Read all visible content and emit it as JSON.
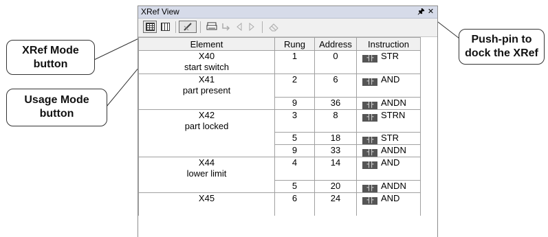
{
  "window": {
    "title": "XRef View",
    "pin_glyph": "↕",
    "close_glyph": "✕"
  },
  "toolbar": {
    "buttons": [
      {
        "name": "xref-mode",
        "icon": "grid-icon",
        "state": "pressed"
      },
      {
        "name": "usage-mode",
        "icon": "list-icon",
        "state": "normal"
      },
      {
        "name": "filter",
        "icon": "pencil-icon",
        "state": "pressed"
      },
      {
        "name": "print",
        "icon": "printer-icon",
        "state": "normal"
      },
      {
        "name": "goto",
        "icon": "jump-icon",
        "state": "disabled"
      },
      {
        "name": "back",
        "icon": "triangle-left-icon",
        "state": "disabled"
      },
      {
        "name": "forward",
        "icon": "triangle-right-icon",
        "state": "disabled"
      },
      {
        "name": "erase",
        "icon": "eraser-icon",
        "state": "disabled"
      }
    ]
  },
  "table": {
    "headers": [
      "Element",
      "Rung",
      "Address",
      "Instruction"
    ],
    "rows": [
      {
        "element": "X40",
        "desc": "start switch",
        "refs": [
          {
            "rung": "1",
            "address": "0",
            "instruction": "STR"
          }
        ]
      },
      {
        "element": "X41",
        "desc": "part present",
        "refs": [
          {
            "rung": "2",
            "address": "6",
            "instruction": "AND"
          },
          {
            "rung": "9",
            "address": "36",
            "instruction": "ANDN"
          }
        ]
      },
      {
        "element": "X42",
        "desc": "part locked",
        "refs": [
          {
            "rung": "3",
            "address": "8",
            "instruction": "STRN"
          },
          {
            "rung": "5",
            "address": "18",
            "instruction": "STR"
          },
          {
            "rung": "9",
            "address": "33",
            "instruction": "ANDN"
          }
        ]
      },
      {
        "element": "X44",
        "desc": "lower limit",
        "refs": [
          {
            "rung": "4",
            "address": "14",
            "instruction": "AND"
          },
          {
            "rung": "5",
            "address": "20",
            "instruction": "ANDN"
          }
        ]
      },
      {
        "element": "X45",
        "desc": "",
        "refs": [
          {
            "rung": "6",
            "address": "24",
            "instruction": "AND"
          }
        ]
      }
    ],
    "contact_glyph": "┤├"
  },
  "callouts": {
    "xref_mode": {
      "line1": "XRef Mode",
      "line2": "button"
    },
    "usage_mode": {
      "line1": "Usage Mode",
      "line2": "button"
    },
    "push_pin": {
      "line1": "Push-pin to",
      "line2": "dock the XRef"
    }
  }
}
